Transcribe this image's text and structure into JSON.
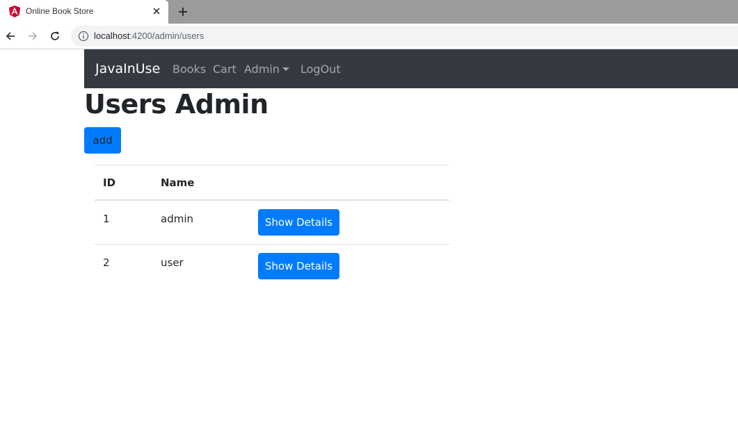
{
  "browser": {
    "tab_title": "Online Book Store",
    "url_host": "localhost",
    "url_rest": ":4200/admin/users"
  },
  "navbar": {
    "brand": "JavaInUse",
    "links": [
      "Books",
      "Cart",
      "Admin",
      "LogOut"
    ]
  },
  "page": {
    "title": "Users Admin",
    "add_label": "add"
  },
  "table": {
    "headers": [
      "ID",
      "Name",
      ""
    ],
    "rows": [
      {
        "id": "1",
        "name": "admin",
        "action": "Show Details"
      },
      {
        "id": "2",
        "name": "user",
        "action": "Show Details"
      }
    ]
  },
  "colors": {
    "navbar_bg": "#343a40",
    "primary": "#007bff"
  }
}
